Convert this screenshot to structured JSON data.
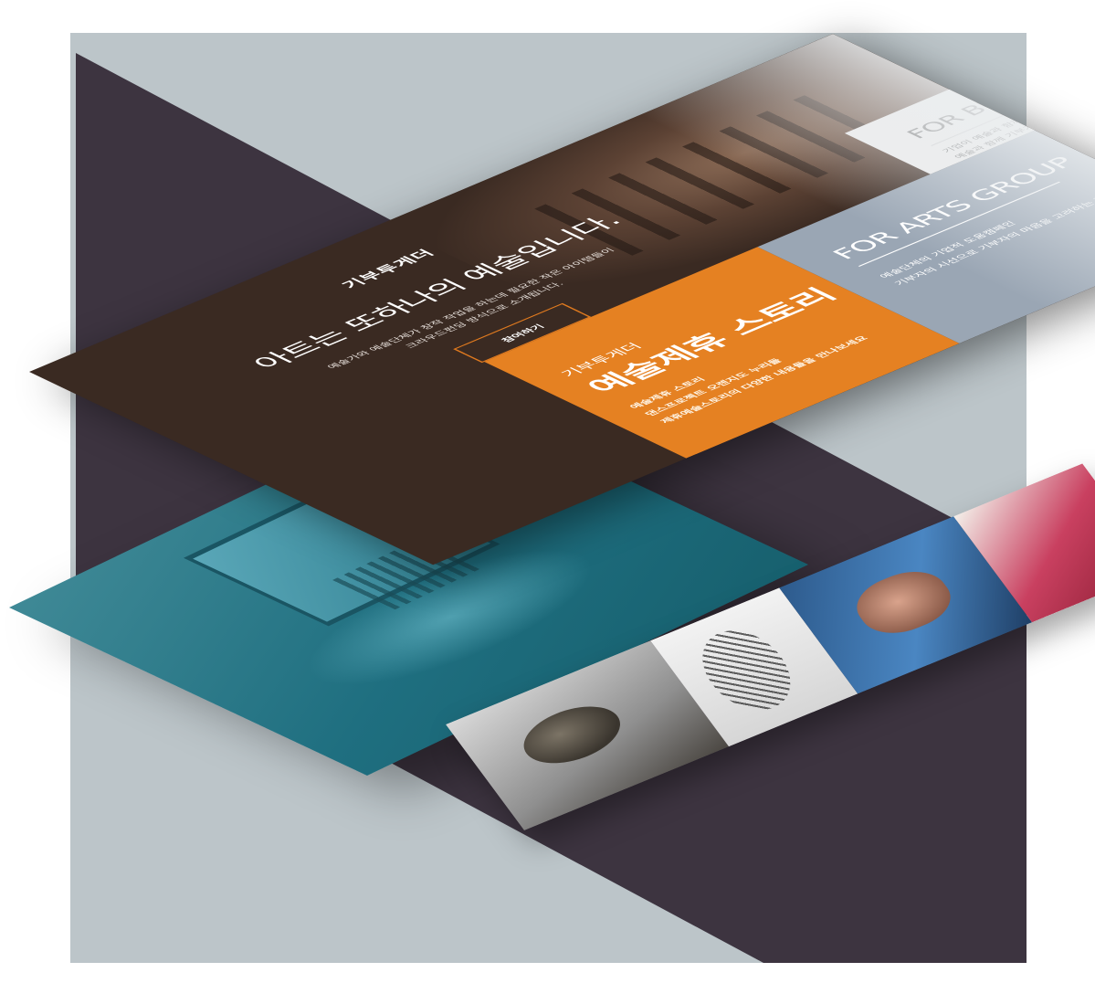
{
  "hero": {
    "brand": "기부투게더",
    "headline": "아트는 또하나의 예술입니다.",
    "desc_line1": "예술가와 예술단체가 창작 작업을 하는데 필요한 작은 아이템들이",
    "desc_line2": "크라우드펀딩 방식으로 소개됩니다.",
    "cta_label": "참여하기"
  },
  "cards": {
    "orange": {
      "small": "기부투게더",
      "title": "예술제휴 스토리",
      "lines": [
        "예술제휴 스토리",
        "댄스프로젝트 오렌지도 누리들",
        "제휴예술스토리의 다양한 내용들을 만나보세요"
      ]
    },
    "gray": {
      "title": "FOR ARTS GROUP",
      "lines": [
        "예술단체의 기업적 도움캠페인",
        "기부자의 시선으로 기부자의 마음을 고려하는 전략 소개"
      ]
    },
    "white": {
      "title": "FOR BUSINESS GROUP",
      "lines": [
        "기업이 예술과 함께 하는 방법",
        "예술과 함께 기부가 가능"
      ]
    }
  },
  "colors": {
    "orange": "#e58122",
    "brown": "#3a2a22",
    "teal": "#1f6f80",
    "slate": "#9aa6b4",
    "dark_purple": "#3d3440"
  }
}
